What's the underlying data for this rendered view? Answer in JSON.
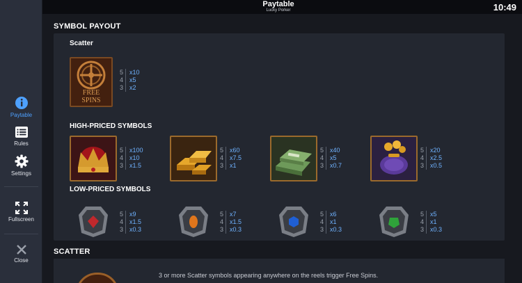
{
  "header": {
    "title": "Paytable",
    "subtitle": "Lucky Porker",
    "clock": "10:49"
  },
  "sidebar": {
    "items": [
      {
        "label": "Paytable",
        "icon": "info-icon",
        "active": true
      },
      {
        "label": "Rules",
        "icon": "list-icon"
      },
      {
        "label": "Settings",
        "icon": "gear-icon"
      },
      {
        "label": "Fullscreen",
        "icon": "fullscreen-icon"
      },
      {
        "label": "Close",
        "icon": "close-icon"
      }
    ]
  },
  "symbol_payout": {
    "title": "SYMBOL PAYOUT",
    "scatter": {
      "title": "Scatter",
      "symbol_text": [
        "FREE",
        "SPINS"
      ],
      "payouts": [
        {
          "count": "5",
          "value": "x10"
        },
        {
          "count": "4",
          "value": "x5"
        },
        {
          "count": "3",
          "value": "x2"
        }
      ]
    },
    "high": {
      "title": "HIGH-PRICED SYMBOLS",
      "symbols": [
        {
          "name": "crown",
          "payouts": [
            {
              "count": "5",
              "value": "x100"
            },
            {
              "count": "4",
              "value": "x10"
            },
            {
              "count": "3",
              "value": "x1.5"
            }
          ]
        },
        {
          "name": "gold-bars",
          "payouts": [
            {
              "count": "5",
              "value": "x60"
            },
            {
              "count": "4",
              "value": "x7.5"
            },
            {
              "count": "3",
              "value": "x1"
            }
          ]
        },
        {
          "name": "cash-stack",
          "payouts": [
            {
              "count": "5",
              "value": "x40"
            },
            {
              "count": "4",
              "value": "x5"
            },
            {
              "count": "3",
              "value": "x0.7"
            }
          ]
        },
        {
          "name": "coin-purse",
          "payouts": [
            {
              "count": "5",
              "value": "x20"
            },
            {
              "count": "4",
              "value": "x2.5"
            },
            {
              "count": "3",
              "value": "x0.5"
            }
          ]
        }
      ]
    },
    "low": {
      "title": "LOW-PRICED SYMBOLS",
      "symbols": [
        {
          "name": "red-gem",
          "color": "#c0282c",
          "payouts": [
            {
              "count": "5",
              "value": "x9"
            },
            {
              "count": "4",
              "value": "x1.5"
            },
            {
              "count": "3",
              "value": "x0.3"
            }
          ]
        },
        {
          "name": "orange-gem",
          "color": "#e0761c",
          "payouts": [
            {
              "count": "5",
              "value": "x7"
            },
            {
              "count": "4",
              "value": "x1.5"
            },
            {
              "count": "3",
              "value": "x0.3"
            }
          ]
        },
        {
          "name": "blue-gem",
          "color": "#1f5fd4",
          "payouts": [
            {
              "count": "5",
              "value": "x6"
            },
            {
              "count": "4",
              "value": "x1"
            },
            {
              "count": "3",
              "value": "x0.3"
            }
          ]
        },
        {
          "name": "green-gem",
          "color": "#2fa33a",
          "payouts": [
            {
              "count": "5",
              "value": "x5"
            },
            {
              "count": "4",
              "value": "x1"
            },
            {
              "count": "3",
              "value": "x0.3"
            }
          ]
        }
      ]
    }
  },
  "scatter_section": {
    "title": "SCATTER",
    "text": "3 or more Scatter symbols appearing anywhere on the reels trigger Free Spins."
  }
}
